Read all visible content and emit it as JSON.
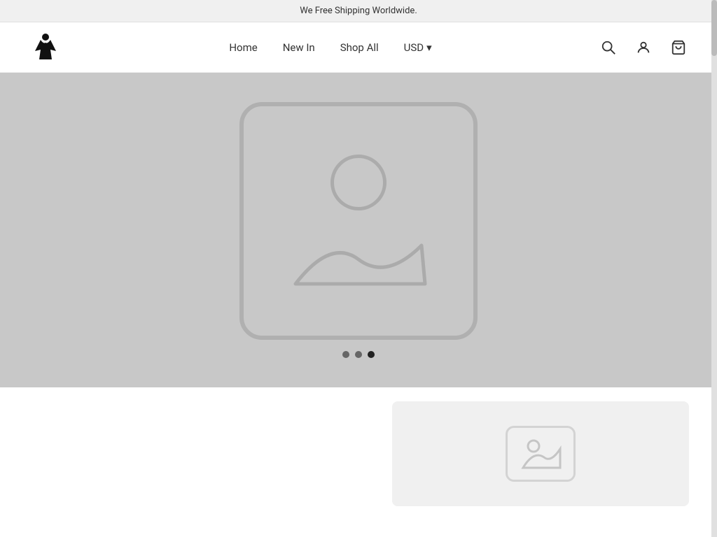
{
  "announcement": {
    "text": "We Free Shipping Worldwide."
  },
  "header": {
    "logo_alt": "Shop logo - dress icon",
    "nav": {
      "home_label": "Home",
      "new_in_label": "New In",
      "shop_all_label": "Shop All",
      "currency_label": "USD",
      "currency_arrow": "▾"
    },
    "icons": {
      "search": "search-icon",
      "account": "account-icon",
      "cart": "cart-icon"
    }
  },
  "hero": {
    "carousel_dots": [
      {
        "active": false
      },
      {
        "active": false
      },
      {
        "active": true
      }
    ]
  },
  "products": {
    "card_placeholder": "image-placeholder"
  }
}
